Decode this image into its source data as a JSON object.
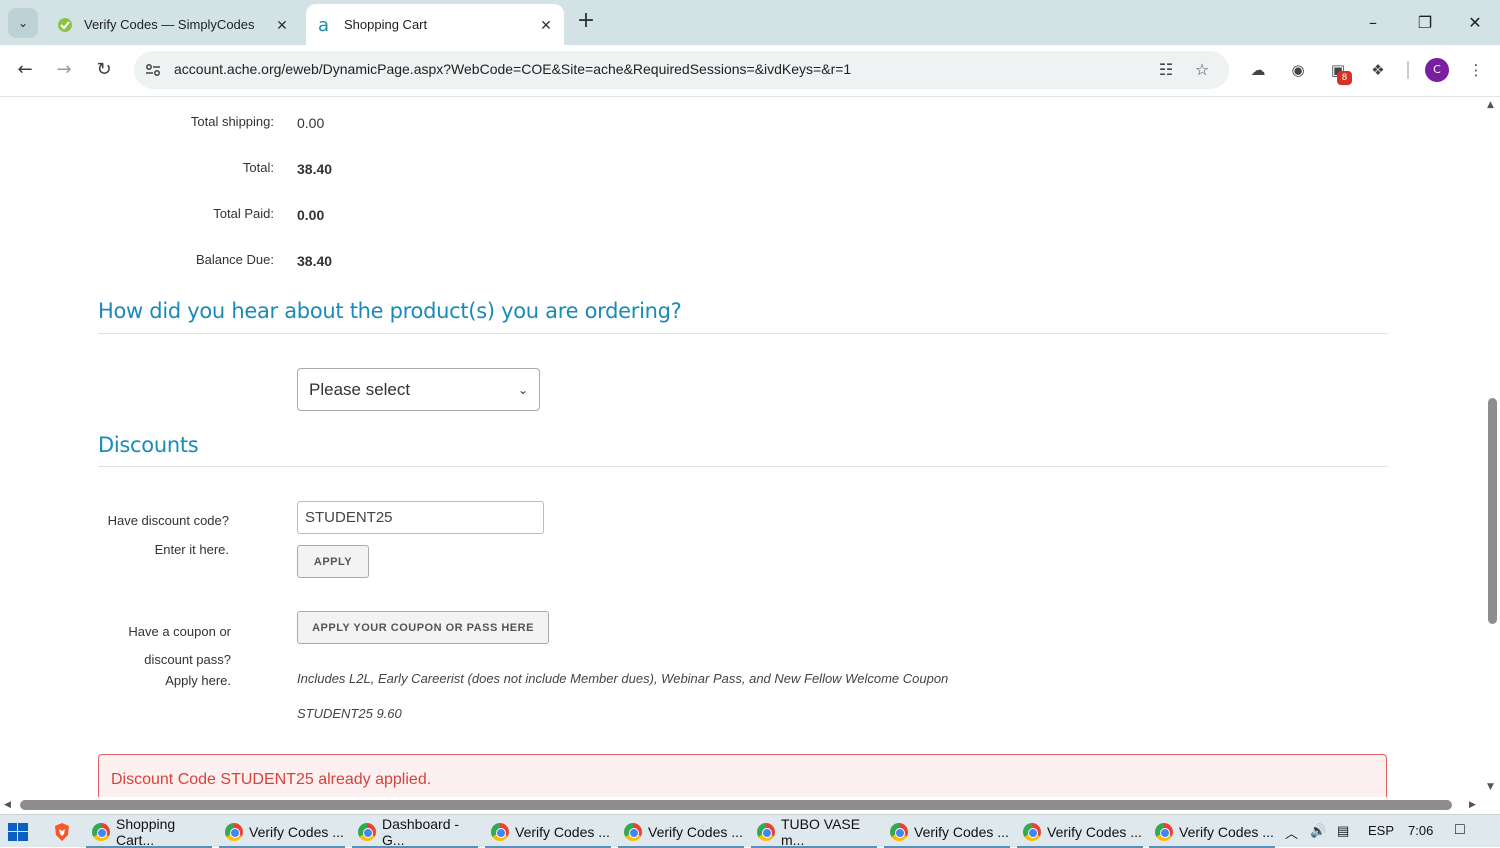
{
  "browser": {
    "tabs": [
      {
        "title": "Verify Codes — SimplyCodes",
        "icon": "simplycodes-icon",
        "active": false
      },
      {
        "title": "Shopping Cart",
        "icon": "ache-icon",
        "active": true
      }
    ],
    "url": "account.ache.org/eweb/DynamicPage.aspx?WebCode=COE&Site=ache&RequiredSessions=&ivdKeys=&r=1",
    "extension_badge": "8",
    "profile_initial": "C"
  },
  "summary": {
    "rows": [
      {
        "label": "Total shipping:",
        "value": "0.00",
        "bold": false
      },
      {
        "label": "Total:",
        "value": "38.40",
        "bold": true
      },
      {
        "label": "Total Paid:",
        "value": "0.00",
        "bold": true
      },
      {
        "label": "Balance Due:",
        "value": "38.40",
        "bold": true
      }
    ]
  },
  "hear_section": {
    "heading": "How did you hear about the product(s) you are ordering?",
    "select_value": "Please select"
  },
  "discounts": {
    "heading": "Discounts",
    "code_label_1": "Have discount code?",
    "code_label_2": "Enter it here.",
    "code_value": "STUDENT25",
    "apply_label": "APPLY",
    "coupon_label_1": "Have a coupon or",
    "coupon_label_2": "discount pass?",
    "coupon_label_3": "Apply here.",
    "coupon_button": "APPLY YOUR COUPON OR PASS HERE",
    "includes_note": "Includes L2L, Early Careerist (does not include Member dues), Webinar Pass, and New Fellow Welcome Coupon",
    "applied_line": "STUDENT25 9.60",
    "alert": "Discount Code STUDENT25 already applied."
  },
  "taskbar": {
    "items": [
      "Shopping Cart...",
      "Verify Codes ...",
      "Dashboard - G...",
      "Verify Codes ...",
      "Verify Codes ...",
      "TUBO VASE m...",
      "Verify Codes ...",
      "Verify Codes ...",
      "Verify Codes ..."
    ],
    "language": "ESP",
    "time": "7:06"
  },
  "colors": {
    "heading": "#1a8ab8",
    "alert_text": "#d9423a",
    "tabstrip": "#d3e3e5"
  }
}
